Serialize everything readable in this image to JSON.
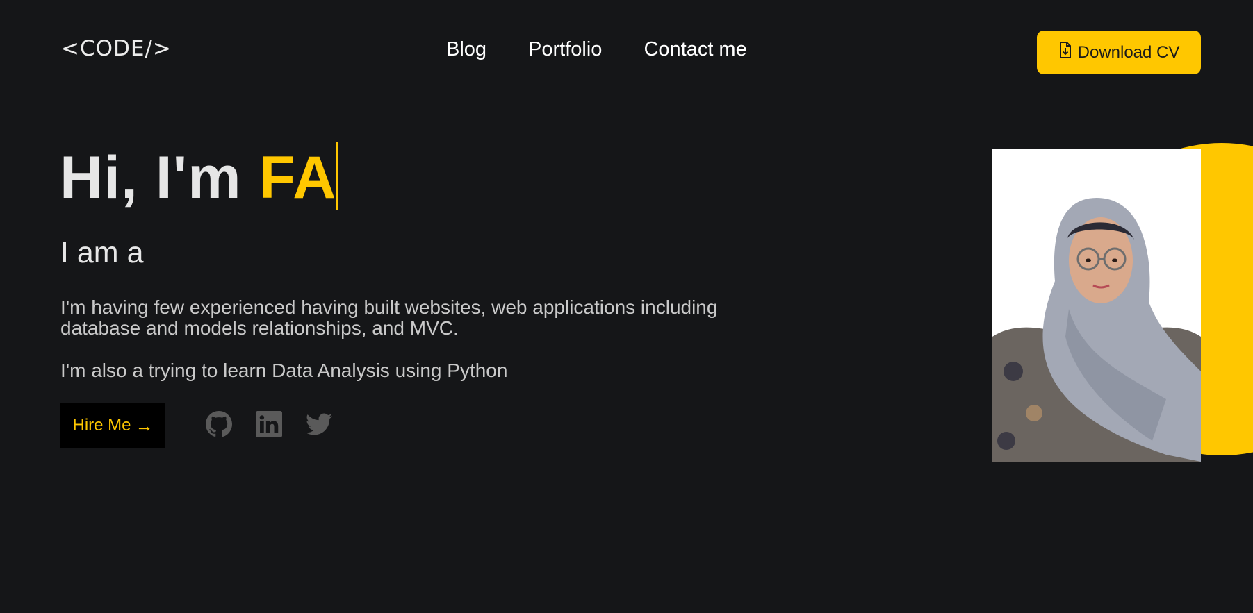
{
  "header": {
    "logo": "<CODE/>",
    "nav": [
      "Blog",
      "Portfolio",
      "Contact me"
    ],
    "cv_button": "Download CV",
    "cv_icon": "file-download-icon"
  },
  "hero": {
    "greeting": "Hi, I'm ",
    "typed_name": "FA",
    "role_prefix": "I am a",
    "description": "I'm having few experienced having built websites, web applications including database and models relationships, and MVC.",
    "description_2": "I'm also a trying to learn Data Analysis using Python",
    "hire_button": "Hire Me",
    "hire_icon": "arrow-right-icon",
    "socials": [
      "github-icon",
      "linkedin-icon",
      "twitter-icon"
    ]
  },
  "colors": {
    "background": "#151618",
    "accent": "#ffc700",
    "text": "#e6e6e6",
    "muted_icon": "#5a5a5a"
  }
}
